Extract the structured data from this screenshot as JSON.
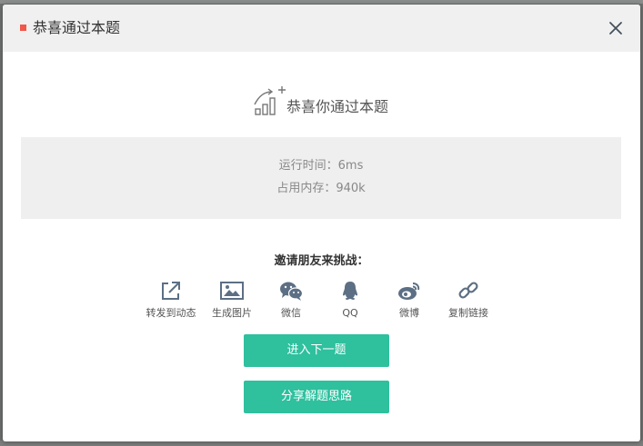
{
  "modal": {
    "title": "恭喜通过本题",
    "close_icon": "close-icon",
    "accent_color": "#f0584b"
  },
  "result": {
    "icon": "chart-up-icon",
    "message": "恭喜你通过本题",
    "runtime": "运行时间：6ms",
    "memory": "占用内存：940k"
  },
  "share": {
    "label": "邀请朋友来挑战：",
    "items": [
      {
        "label": "转发到动态",
        "icon": "external-share-icon"
      },
      {
        "label": "生成图片",
        "icon": "image-icon"
      },
      {
        "label": "微信",
        "icon": "wechat-icon"
      },
      {
        "label": "QQ",
        "icon": "qq-icon"
      },
      {
        "label": "微博",
        "icon": "weibo-icon"
      },
      {
        "label": "复制链接",
        "icon": "link-icon"
      }
    ]
  },
  "actions": {
    "next_label": "进入下一题",
    "share_solution_label": "分享解题思路",
    "button_color": "#2fc09e"
  }
}
